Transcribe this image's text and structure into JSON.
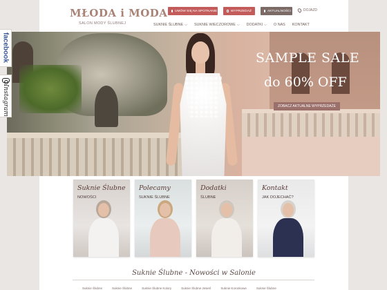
{
  "social": {
    "facebook": "facebook",
    "instagram": "Instagram"
  },
  "header": {
    "logo": "MŁODA i MODA",
    "tagline": "SALON MODY ŚLUBNEJ",
    "buttons": [
      "UMÓW SIĘ NA SPOTKANIE",
      "WYPRZEDAŻ",
      "AKTUALNOŚCI"
    ],
    "location": "DOJAZD",
    "nav": [
      {
        "label": "SUKNIE ŚLUBNE",
        "has_dropdown": true
      },
      {
        "label": "SUKNIE WIECZOROWE",
        "has_dropdown": true
      },
      {
        "label": "DODATKI",
        "has_dropdown": true
      },
      {
        "label": "O NAS",
        "has_dropdown": false
      },
      {
        "label": "KONTAKT",
        "has_dropdown": false
      }
    ]
  },
  "hero": {
    "line1": "SAMPLE SALE",
    "line2": "do 60% OFF",
    "button": "ZOBACZ AKTUALNE WYPRZEDAŻE"
  },
  "cards": [
    {
      "title": "Suknie Ślubne",
      "subtitle": "NOWOŚCI"
    },
    {
      "title": "Polecamy",
      "subtitle": "SUKNIE ŚLUBNE"
    },
    {
      "title": "Dodatki",
      "subtitle": "ŚLUBNE"
    },
    {
      "title": "Kontakt",
      "subtitle": "JAK DOJECHAĆ?"
    }
  ],
  "section": {
    "title": "Suknie Ślubne - Nowości w Salonie",
    "filters": [
      "Suknie Ślubne",
      "Suknie Ślubne",
      "Suknie Ślubne Kolory",
      "Suknie Ślubne Jesień",
      "Suknie Koronkowe",
      "Suknie Ślubne"
    ]
  },
  "colors": {
    "accent_red": "#c35b5b",
    "brand": "#a88276",
    "dark_button": "#7b6a66"
  }
}
